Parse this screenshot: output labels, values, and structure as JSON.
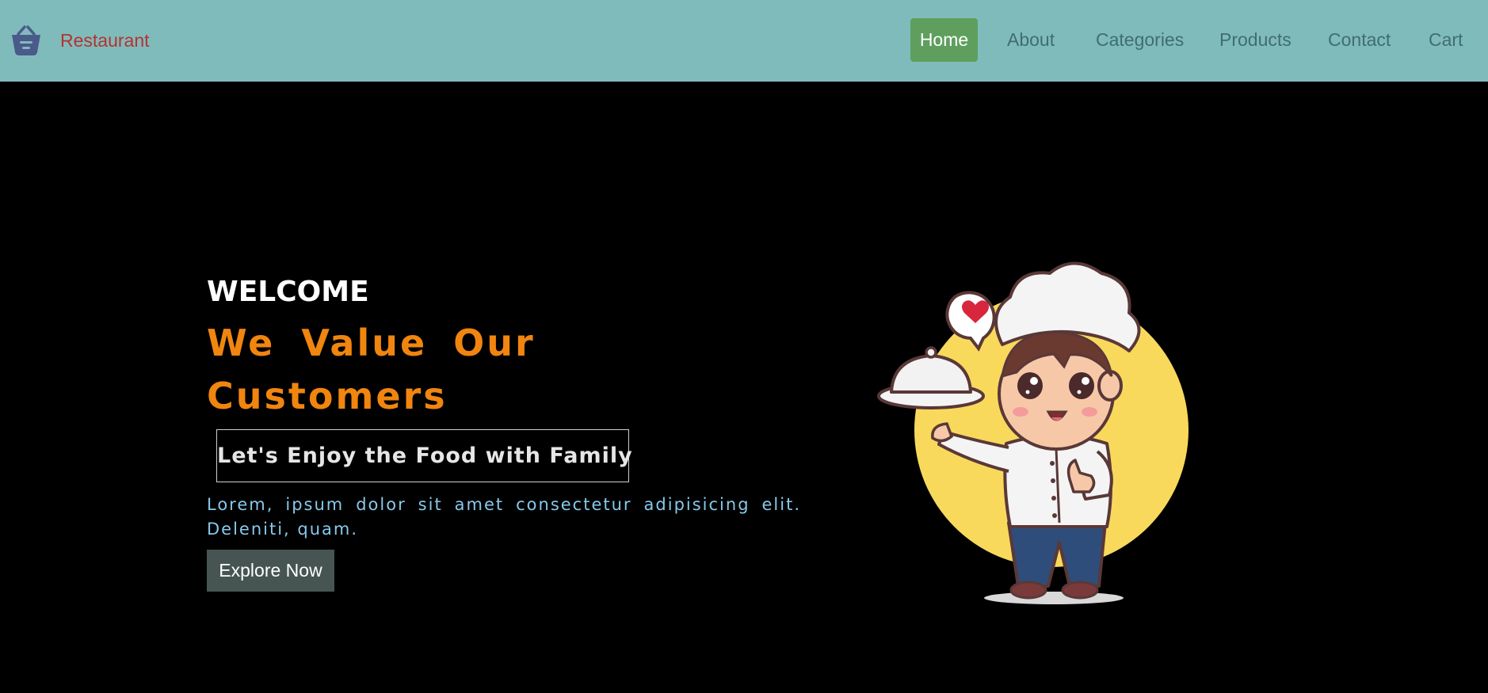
{
  "navbar": {
    "brand_icon": "basket-icon",
    "brand_name": "Restaurant",
    "items": [
      {
        "label": "Home",
        "active": true
      },
      {
        "label": "About",
        "active": false
      },
      {
        "label": "Categories",
        "active": false
      },
      {
        "label": "Products",
        "active": false
      },
      {
        "label": "Contact",
        "active": false
      },
      {
        "label": "Cart",
        "active": false
      }
    ]
  },
  "hero": {
    "welcome": "WELCOME",
    "headline": "We Value Our Customers",
    "tagline": "Let's Enjoy the Food with Family",
    "description": "Lorem, ipsum dolor sit amet consectetur adipisicing elit. Deleniti, quam.",
    "button_label": "Explore Now",
    "illustration": "chef-illustration"
  },
  "colors": {
    "navbar_bg": "#80bbbc",
    "brand_text": "#b5332e",
    "nav_text": "#3f6e6f",
    "active_nav_bg": "#5e9f5d",
    "headline": "#f0850f",
    "description": "#86c9ea",
    "button_bg": "#465551",
    "page_bg": "#000000"
  }
}
